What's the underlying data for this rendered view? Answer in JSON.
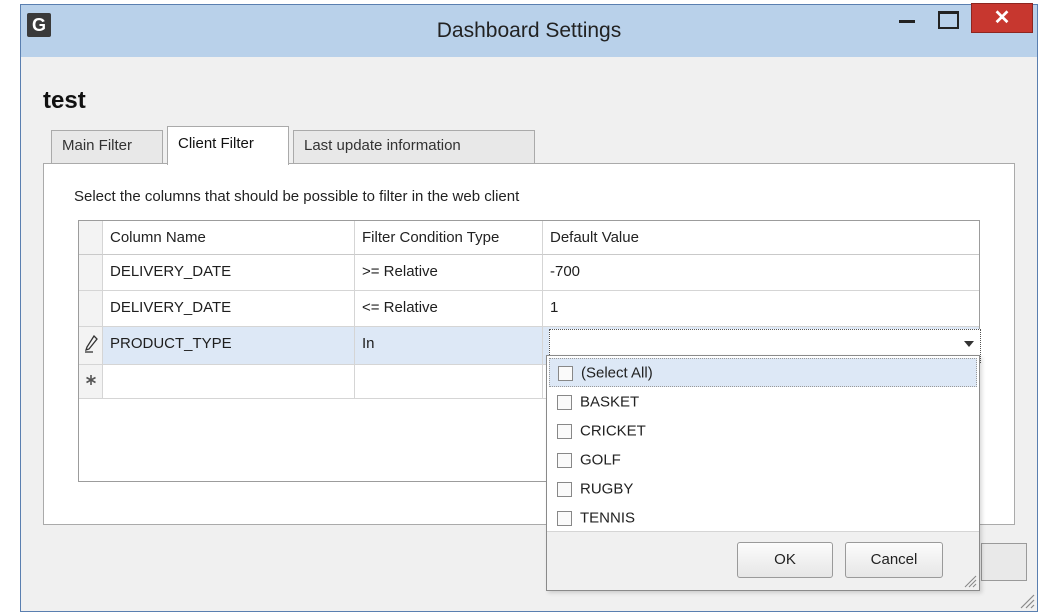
{
  "window": {
    "title": "Dashboard Settings",
    "app_icon_letter": "G",
    "close_glyph": "✕"
  },
  "dialog": {
    "heading": "test"
  },
  "tabs": [
    {
      "label": "Main Filter",
      "active": false
    },
    {
      "label": "Client Filter",
      "active": true
    },
    {
      "label": "Last update information",
      "active": false
    }
  ],
  "client_filter": {
    "description": "Select the columns that should be possible to filter in the web client",
    "columns": [
      "Column Name",
      "Filter Condition Type",
      "Default Value"
    ],
    "rows": [
      {
        "indicator": "",
        "column_name": "DELIVERY_DATE",
        "condition": ">= Relative",
        "default_value": "-700"
      },
      {
        "indicator": "",
        "column_name": "DELIVERY_DATE",
        "condition": "<= Relative",
        "default_value": "1"
      },
      {
        "indicator": "pencil-icon",
        "column_name": "PRODUCT_TYPE",
        "condition": "In",
        "default_value": ""
      },
      {
        "indicator": "asterisk-icon",
        "column_name": "",
        "condition": "",
        "default_value": ""
      }
    ]
  },
  "dropdown": {
    "options": [
      {
        "label": "(Select All)",
        "checked": false
      },
      {
        "label": "BASKET",
        "checked": false
      },
      {
        "label": "CRICKET",
        "checked": false
      },
      {
        "label": "GOLF",
        "checked": false
      },
      {
        "label": "RUGBY",
        "checked": false
      },
      {
        "label": "TENNIS",
        "checked": false
      }
    ],
    "ok_label": "OK",
    "cancel_label": "Cancel"
  },
  "colors": {
    "titlebar": "#b9d1ea",
    "close_button": "#c7372f",
    "selected_row": "#dde8f6"
  }
}
